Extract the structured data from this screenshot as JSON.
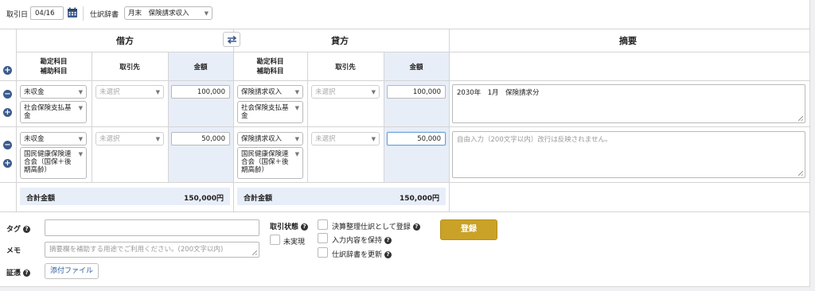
{
  "filters": {
    "date_label": "取引日",
    "date_value": "04/16",
    "dict_label": "仕訳辞書",
    "dict_value": "月末　保険請求収入"
  },
  "headers": {
    "debit": "借方",
    "credit": "貸方",
    "memo": "摘要",
    "account_line1": "勘定科目",
    "account_line2": "補助科目",
    "partner": "取引先",
    "amount": "金額"
  },
  "rows": [
    {
      "debit_account": "未収金",
      "debit_sub": "社会保険支払基金",
      "debit_partner": "未選択",
      "debit_amount": "100,000",
      "credit_account": "保険請求収入",
      "credit_sub": "社会保険支払基金",
      "credit_partner": "未選択",
      "credit_amount": "100,000",
      "memo": "2030年　1月　保険請求分"
    },
    {
      "debit_account": "未収金",
      "debit_sub": "国民健康保険連合会（国保＋後期高齢）",
      "debit_partner": "未選択",
      "debit_amount": "50,000",
      "credit_account": "保険請求収入",
      "credit_sub": "国民健康保険連合会（国保＋後期高齢）",
      "credit_partner": "未選択",
      "credit_amount": "50,000",
      "memo_placeholder": "自由入力（200文字以内）改行は反映されません。"
    }
  ],
  "totals": {
    "label": "合計金額",
    "debit": "150,000円",
    "credit": "150,000円"
  },
  "footer": {
    "tag_label": "タグ",
    "memo_label": "メモ",
    "memo_placeholder": "摘要欄を補助する用途でご利用ください。(200文字以内)",
    "evidence_label": "証憑",
    "attach_button": "添付ファイル",
    "status_label": "取引状態",
    "unrealized": "未実現",
    "opt_settlement": "決算整理仕訳として登録",
    "opt_keep": "入力内容を保持",
    "opt_update_dict": "仕訳辞書を更新",
    "register_button": "登録"
  },
  "colors": {
    "accent_blue": "#3b5b8c",
    "amount_column_bg": "#e8eef8",
    "register_gold": "#c9a227"
  },
  "icons": {
    "calendar": "calendar-icon",
    "swap": "swap-icon",
    "add": "plus-circle-icon",
    "remove": "minus-circle-icon",
    "help": "question-icon",
    "dropdown": "chevron-down-icon"
  }
}
